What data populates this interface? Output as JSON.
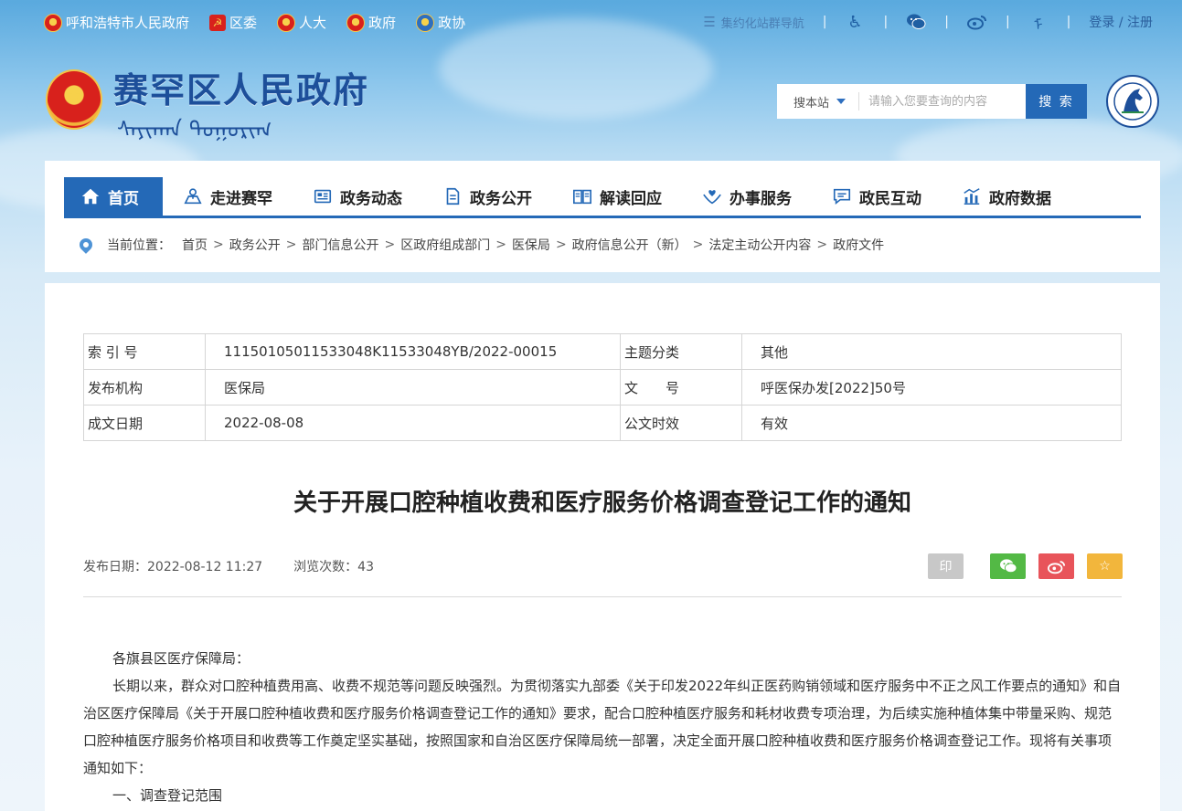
{
  "topbar": {
    "links": [
      {
        "label": "呼和浩特市人民政府",
        "icon": "national-emblem-icon"
      },
      {
        "label": "区委",
        "icon": "party-emblem-icon"
      },
      {
        "label": "人大",
        "icon": "national-emblem-icon"
      },
      {
        "label": "政府",
        "icon": "national-emblem-icon"
      },
      {
        "label": "政协",
        "icon": "cppcc-emblem-icon"
      }
    ],
    "group_nav": "集约化站群导航",
    "login": "登录 / 注册"
  },
  "header": {
    "site_title": "赛罕区人民政府",
    "mongol_text": "ᠰᠠᠶᠢᠬᠠᠨ ᠲᠣᠭᠣᠷᠢᠭ",
    "search": {
      "scope": "搜本站",
      "placeholder": "请输入您要查询的内容",
      "button": "搜 索"
    }
  },
  "nav": {
    "items": [
      {
        "label": "首页",
        "icon": "home-icon"
      },
      {
        "label": "走进赛罕",
        "icon": "map-icon"
      },
      {
        "label": "政务动态",
        "icon": "news-icon"
      },
      {
        "label": "政务公开",
        "icon": "document-icon"
      },
      {
        "label": "解读回应",
        "icon": "book-icon"
      },
      {
        "label": "办事服务",
        "icon": "service-hands-icon"
      },
      {
        "label": "政民互动",
        "icon": "chat-icon"
      },
      {
        "label": "政府数据",
        "icon": "bar-chart-icon"
      }
    ]
  },
  "breadcrumb": {
    "label": "当前位置：",
    "items": [
      "首页",
      "政务公开",
      "部门信息公开",
      "区政府组成部门",
      "医保局",
      "政府信息公开（新）",
      "法定主动公开内容",
      "政府文件"
    ]
  },
  "meta": {
    "rows": [
      {
        "k1": "索 引 号",
        "v1": "11150105011533048K11533048YB/2022-00015",
        "k2": "主题分类",
        "v2": "其他"
      },
      {
        "k1": "发布机构",
        "v1": "医保局",
        "k2": "文　　号",
        "v2": "呼医保办发[2022]50号"
      },
      {
        "k1": "成文日期",
        "v1": "2022-08-08",
        "k2": "公文时效",
        "v2": "有效"
      }
    ]
  },
  "article": {
    "title": "关于开展口腔种植收费和医疗服务价格调查登记工作的通知",
    "publish_label": "发布日期：",
    "publish_date": "2022-08-12 11:27",
    "views_label": "浏览次数：",
    "views": "43",
    "print_label": "印",
    "greeting": "各旗县区医疗保障局：",
    "para1": "长期以来，群众对口腔种植费用高、收费不规范等问题反映强烈。为贯彻落实九部委《关于印发2022年纠正医药购销领域和医疗服务中不正之风工作要点的通知》和自治区医疗保障局《关于开展口腔种植收费和医疗服务价格调查登记工作的通知》要求，配合口腔种植医疗服务和耗材收费专项治理，为后续实施种植体集中带量采购、规范口腔种植医疗服务价格项目和收费等工作奠定坚实基础，按照国家和自治区医疗保障局统一部署，决定全面开展口腔种植收费和医疗服务价格调查登记工作。现将有关事项通知如下：",
    "section1": "一、调查登记范围"
  },
  "colors": {
    "primary": "#2469b7",
    "title_blue": "#1d4f9a",
    "wechat": "#53b945",
    "weibo": "#e8545a",
    "favorite": "#f2b63c"
  }
}
